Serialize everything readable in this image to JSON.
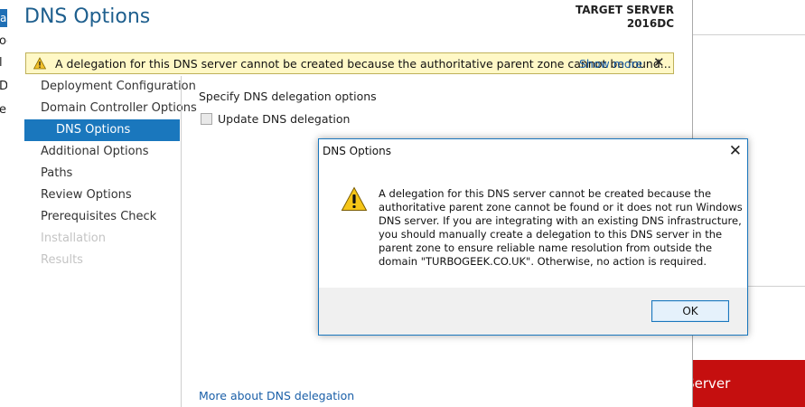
{
  "background": {
    "left_fragments": [
      "as",
      "oc",
      "l",
      "D",
      "e"
    ],
    "right_button_label": "al Server"
  },
  "wizard": {
    "title": "DNS Options",
    "target_server_label": "TARGET SERVER",
    "target_server_name": "2016DC",
    "warning_bar": {
      "icon": "warning-icon",
      "text": "A delegation for this DNS server cannot be created because the authoritative parent zone cannot be found...",
      "link": "Show more",
      "close": "✕"
    },
    "nav": [
      {
        "label": "Deployment Configuration",
        "state": "normal"
      },
      {
        "label": "Domain Controller Options",
        "state": "normal"
      },
      {
        "label": "DNS Options",
        "state": "active"
      },
      {
        "label": "Additional Options",
        "state": "normal"
      },
      {
        "label": "Paths",
        "state": "normal"
      },
      {
        "label": "Review Options",
        "state": "normal"
      },
      {
        "label": "Prerequisites Check",
        "state": "normal"
      },
      {
        "label": "Installation",
        "state": "disabled"
      },
      {
        "label": "Results",
        "state": "disabled"
      }
    ],
    "content": {
      "heading": "Specify DNS delegation options",
      "checkbox_label": "Update DNS delegation",
      "checkbox_checked": false,
      "more_link": "More about DNS delegation"
    }
  },
  "dialog": {
    "title": "DNS Options",
    "close": "✕",
    "icon": "warning-icon",
    "message_lines": [
      "A delegation for this DNS server cannot be created because the",
      "authoritative parent zone cannot be found or it does not run Windows",
      "DNS server. If you are integrating with an existing DNS infrastructure,",
      "you should manually create a delegation to this DNS server in the",
      "parent zone to ensure reliable name resolution from outside the",
      "domain \"TURBOGEEK.CO.UK\". Otherwise, no action is required."
    ],
    "ok_label": "OK"
  },
  "colors": {
    "accent": "#1a77bd",
    "title": "#1e5f8e",
    "warning_bg": "#fff8c6",
    "link": "#1a5fa8",
    "danger": "#c50f0f"
  }
}
